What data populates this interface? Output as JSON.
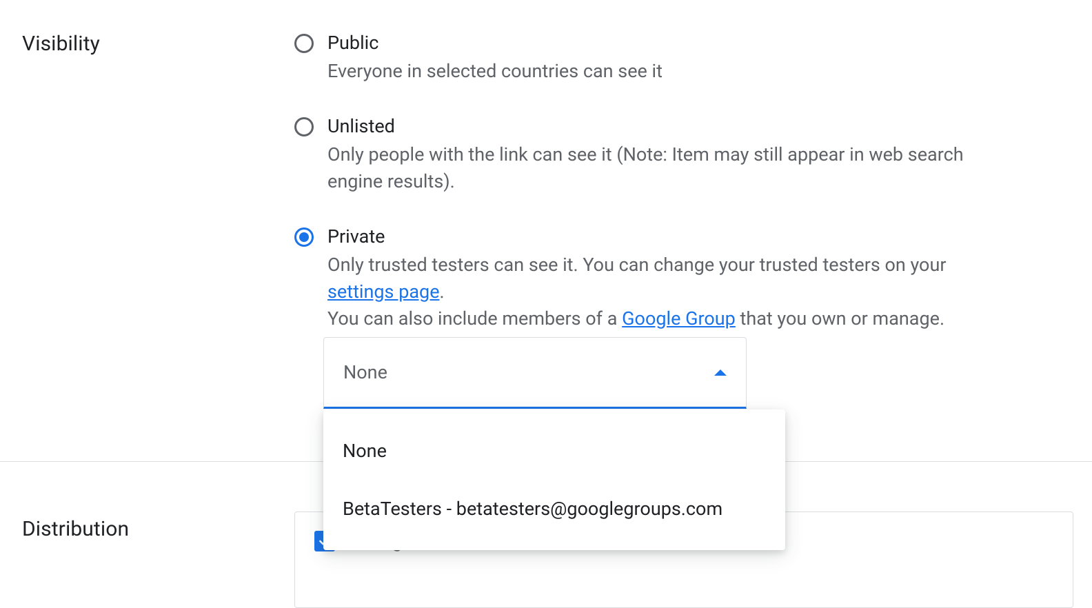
{
  "visibility": {
    "section_label": "Visibility",
    "options": [
      {
        "key": "public",
        "title": "Public",
        "desc": "Everyone in selected countries can see it",
        "selected": false
      },
      {
        "key": "unlisted",
        "title": "Unlisted",
        "desc": "Only people with the link can see it (Note: Item may still appear in web search engine results).",
        "selected": false
      },
      {
        "key": "private",
        "title": "Private",
        "desc_prefix": "Only trusted testers can see it. You can change your trusted testers on your ",
        "link1_text": "settings page",
        "desc_mid1": ".",
        "desc_line2_prefix": "You can also include members of a ",
        "link2_text": "Google Group",
        "desc_line2_suffix": " that you own or manage.",
        "selected": true
      }
    ],
    "group_select": {
      "value": "None",
      "options": [
        "None",
        "BetaTesters - betatesters@googlegroups.com"
      ]
    }
  },
  "distribution": {
    "section_label": "Distribution",
    "all_regions_label": "All regions"
  }
}
